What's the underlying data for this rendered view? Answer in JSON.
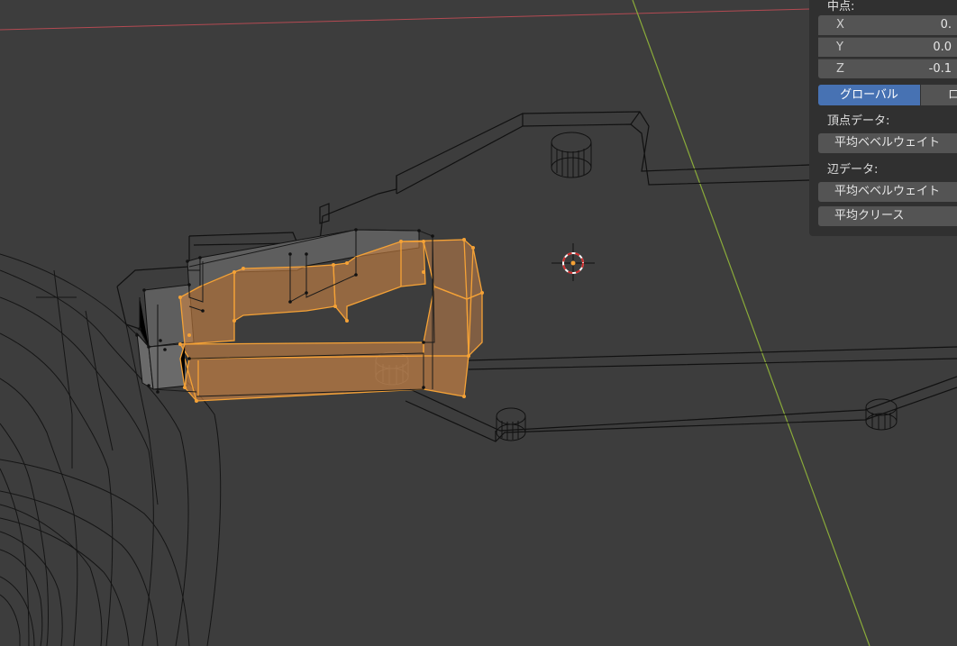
{
  "sidebar": {
    "median_label": "中点:",
    "median": [
      {
        "axis": "X",
        "value": "0."
      },
      {
        "axis": "Y",
        "value": "0.0"
      },
      {
        "axis": "Z",
        "value": "-0.1"
      }
    ],
    "space_global": "グローバル",
    "space_local": "ロ",
    "vertex_data_label": "頂点データ:",
    "vertex_bevel_weight": "平均ベベルウェイト",
    "edge_data_label": "辺データ:",
    "edge_bevel_weight": "平均ベベルウェイト",
    "edge_crease": "平均クリース"
  },
  "colors": {
    "viewport_bg": "#3d3d3d",
    "x_axis": "#b34a52",
    "y_axis": "#8aab3a",
    "selection": "#f5a236",
    "active_toggle": "#4772b3"
  },
  "icons": {
    "cursor": "3d-cursor-icon"
  }
}
